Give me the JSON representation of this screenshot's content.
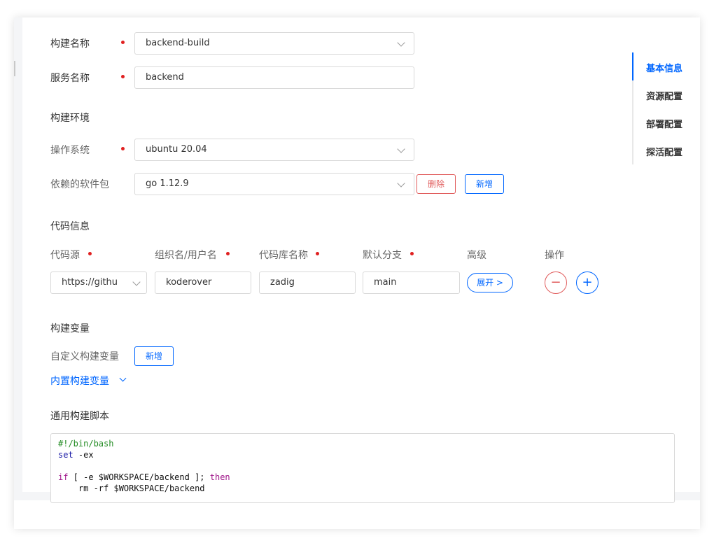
{
  "form": {
    "build_name": {
      "label": "构建名称",
      "value": "backend-build"
    },
    "service_name": {
      "label": "服务名称",
      "value": "backend"
    },
    "build_env": {
      "title": "构建环境",
      "os": {
        "label": "操作系统",
        "value": "ubuntu 20.04"
      },
      "packages": {
        "label": "依赖的软件包",
        "value": "go 1.12.9",
        "delete_label": "删除",
        "add_label": "新增"
      }
    },
    "code_info": {
      "title": "代码信息",
      "headers": [
        "代码源",
        "组织名/用户名",
        "代码库名称",
        "默认分支",
        "高级",
        "操作"
      ],
      "row": {
        "source": "https://githu",
        "org": "koderover",
        "repo": "zadig",
        "branch": "main",
        "expand_label": "展开 >",
        "remove_symbol": "−",
        "add_symbol": "+"
      }
    },
    "build_vars": {
      "title": "构建变量",
      "custom_label": "自定义构建变量",
      "add_label": "新增",
      "builtin_label": "内置构建变量"
    },
    "script": {
      "title": "通用构建脚本",
      "lines": {
        "l1": "#!/bin/bash",
        "l2_kw": "set",
        "l2_rest": " -ex",
        "l4_if": "if",
        "l4_mid": " [ -e $WORKSPACE/backend ]; ",
        "l4_then": "then",
        "l5": "    rm -rf $WORKSPACE/backend"
      }
    }
  },
  "anchor_nav": {
    "items": [
      "基本信息",
      "资源配置",
      "部署配置",
      "探活配置"
    ],
    "active_index": 0
  },
  "colors": {
    "accent": "#0066ff",
    "danger": "#e05a5a",
    "required": "#e02020"
  }
}
